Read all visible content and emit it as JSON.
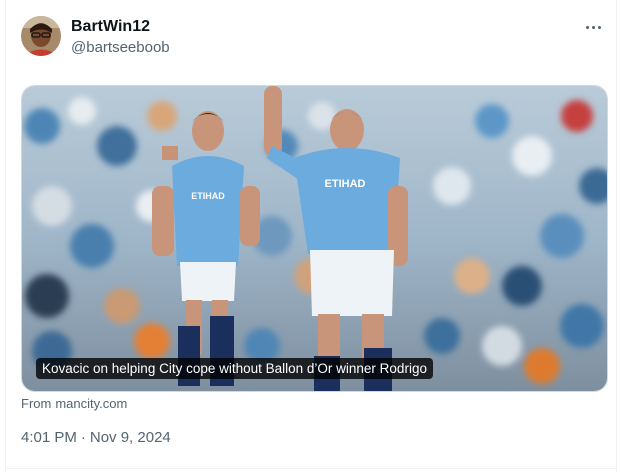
{
  "tweet": {
    "display_name": "BartWin12",
    "handle": "@bartseeboob",
    "avatar": "avatar",
    "more_icon": "more-horizontal-icon"
  },
  "link_card": {
    "caption": "Kovacic on helping City cope without Ballon d’Or winner Rodrigo",
    "source_prefix": "From",
    "source_domain": "mancity.com",
    "player_left_shirt": "ETIHAD AIRWAYS",
    "player_right_shirt": "ETIHAD AIRWAYS"
  },
  "meta": {
    "time": "4:01 PM",
    "separator": "·",
    "date": "Nov 9, 2024"
  },
  "colors": {
    "sky_blue_kit": "#6cabdd",
    "text_primary": "#0f1419",
    "text_secondary": "#536471",
    "border": "#cfd9de"
  }
}
